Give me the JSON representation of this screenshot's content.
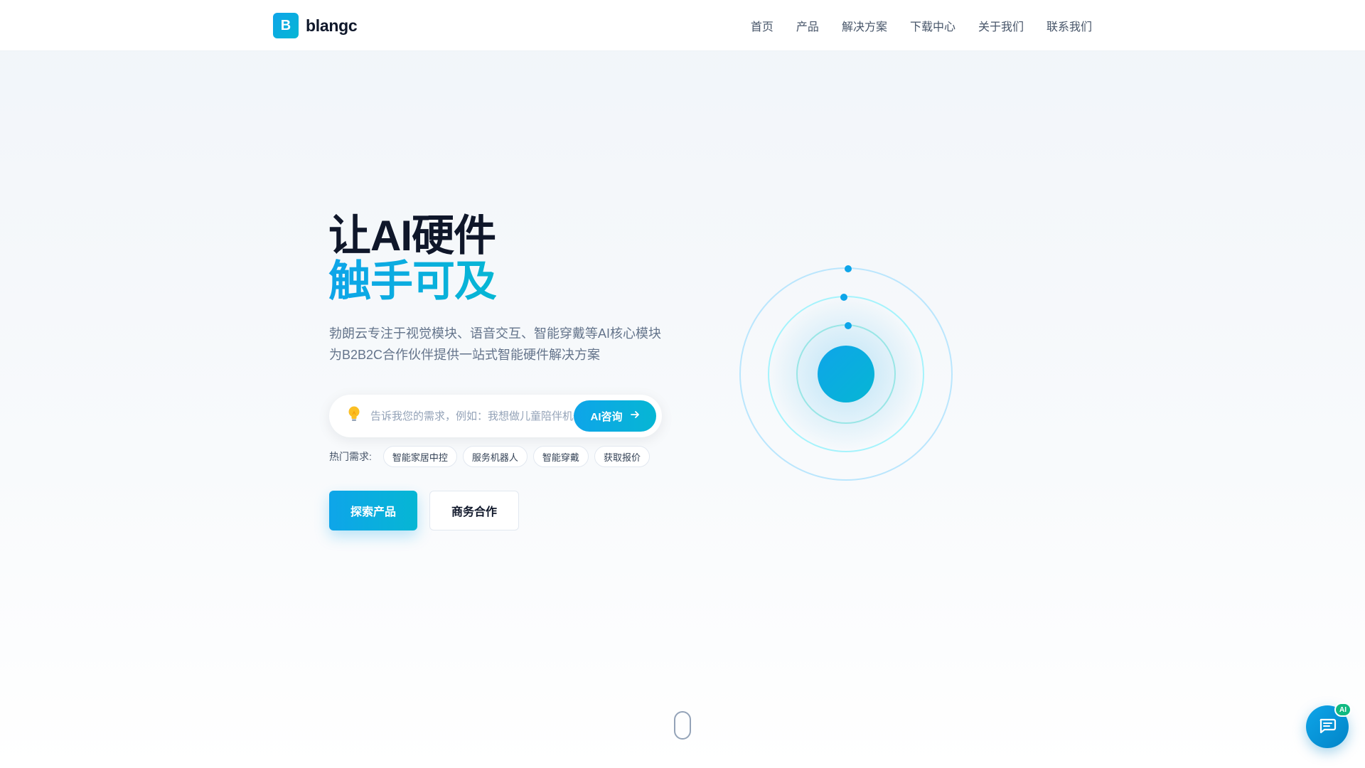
{
  "brand": {
    "logo_letter": "B",
    "name": "blangc",
    "color": "#0ea5e9"
  },
  "nav": {
    "items": [
      {
        "label": "首页"
      },
      {
        "label": "产品"
      },
      {
        "label": "解决方案"
      },
      {
        "label": "下载中心"
      },
      {
        "label": "关于我们"
      },
      {
        "label": "联系我们"
      }
    ]
  },
  "hero": {
    "title_line1": "让AI硬件",
    "title_line2": "触手可及",
    "subtitle_line1": "勃朗云专注于视觉模块、语音交互、智能穿戴等AI核心模块",
    "subtitle_line2": "为B2B2C合作伙伴提供一站式智能硬件解决方案"
  },
  "search": {
    "icon": "lightbulb-icon",
    "placeholder": "告诉我您的需求，例如：我想做儿童陪伴机器人",
    "button_label": "AI咨询"
  },
  "hot": {
    "label": "热门需求:",
    "tags": [
      "智能家居中控",
      "服务机器人",
      "智能穿戴",
      "获取报价"
    ]
  },
  "cta": {
    "primary": "探索产品",
    "secondary": "商务合作"
  },
  "chat": {
    "badge": "AI",
    "icon": "chat-bubble-icon"
  },
  "colors": {
    "accent": "#0ea5e9",
    "accent2": "#06b6d4",
    "badge": "#10b981"
  }
}
